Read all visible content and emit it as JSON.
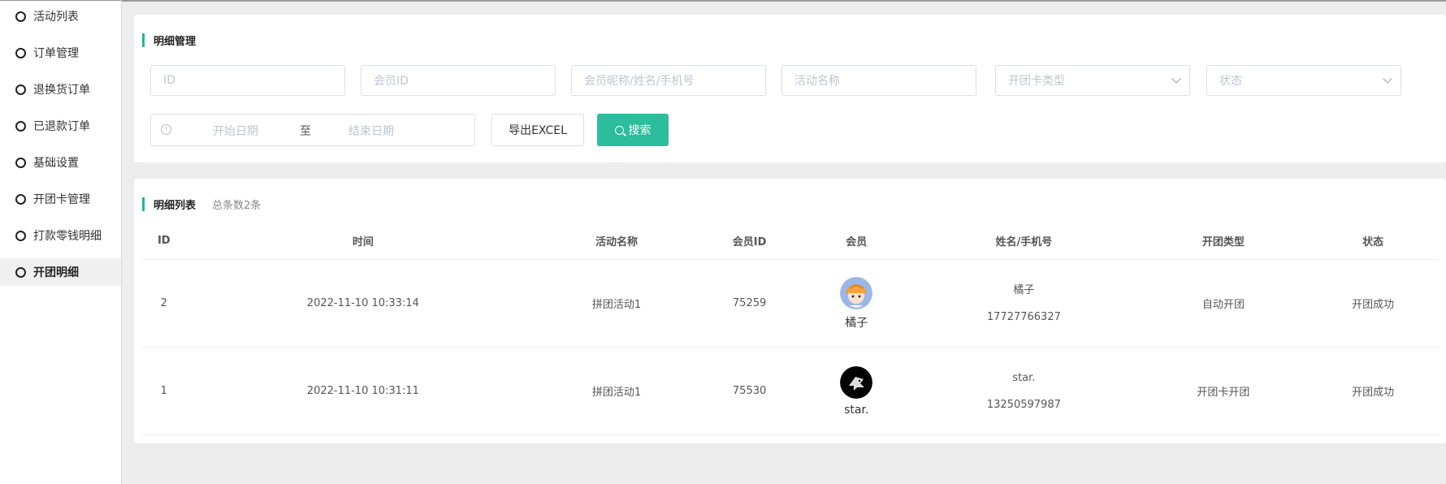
{
  "sidebar": {
    "items": [
      {
        "label": "活动列表",
        "active": false
      },
      {
        "label": "订单管理",
        "active": false
      },
      {
        "label": "退换货订单",
        "active": false
      },
      {
        "label": "已退款订单",
        "active": false
      },
      {
        "label": "基础设置",
        "active": false
      },
      {
        "label": "开团卡管理",
        "active": false
      },
      {
        "label": "打款零钱明细",
        "active": false
      },
      {
        "label": "开团明细",
        "active": true
      }
    ]
  },
  "filter": {
    "title": "明细管理",
    "id_placeholder": "ID",
    "member_id_placeholder": "会员ID",
    "member_name_placeholder": "会员昵称/姓名/手机号",
    "activity_placeholder": "活动名称",
    "card_type_placeholder": "开团卡类型",
    "status_placeholder": "状态",
    "start_date_placeholder": "开始日期",
    "date_separator": "至",
    "end_date_placeholder": "结束日期",
    "export_label": "导出EXCEL",
    "search_label": "搜索"
  },
  "list": {
    "title": "明细列表",
    "total": "总条数2条",
    "columns": [
      "ID",
      "时间",
      "活动名称",
      "会员ID",
      "会员",
      "姓名/手机号",
      "开团类型",
      "状态"
    ],
    "rows": [
      {
        "id": "2",
        "time": "2022-11-10 10:33:14",
        "activity": "拼团活动1",
        "member_id": "75259",
        "member_name": "橘子",
        "name": "橘子",
        "phone": "17727766327",
        "type": "自动开团",
        "status": "开团成功"
      },
      {
        "id": "1",
        "time": "2022-11-10 10:31:11",
        "activity": "拼团活动1",
        "member_id": "75530",
        "member_name": "star.",
        "name": "star.",
        "phone": "13250597987",
        "type": "开团卡开团",
        "status": "开团成功"
      }
    ]
  },
  "colors": {
    "accent": "#2bbd9c"
  }
}
